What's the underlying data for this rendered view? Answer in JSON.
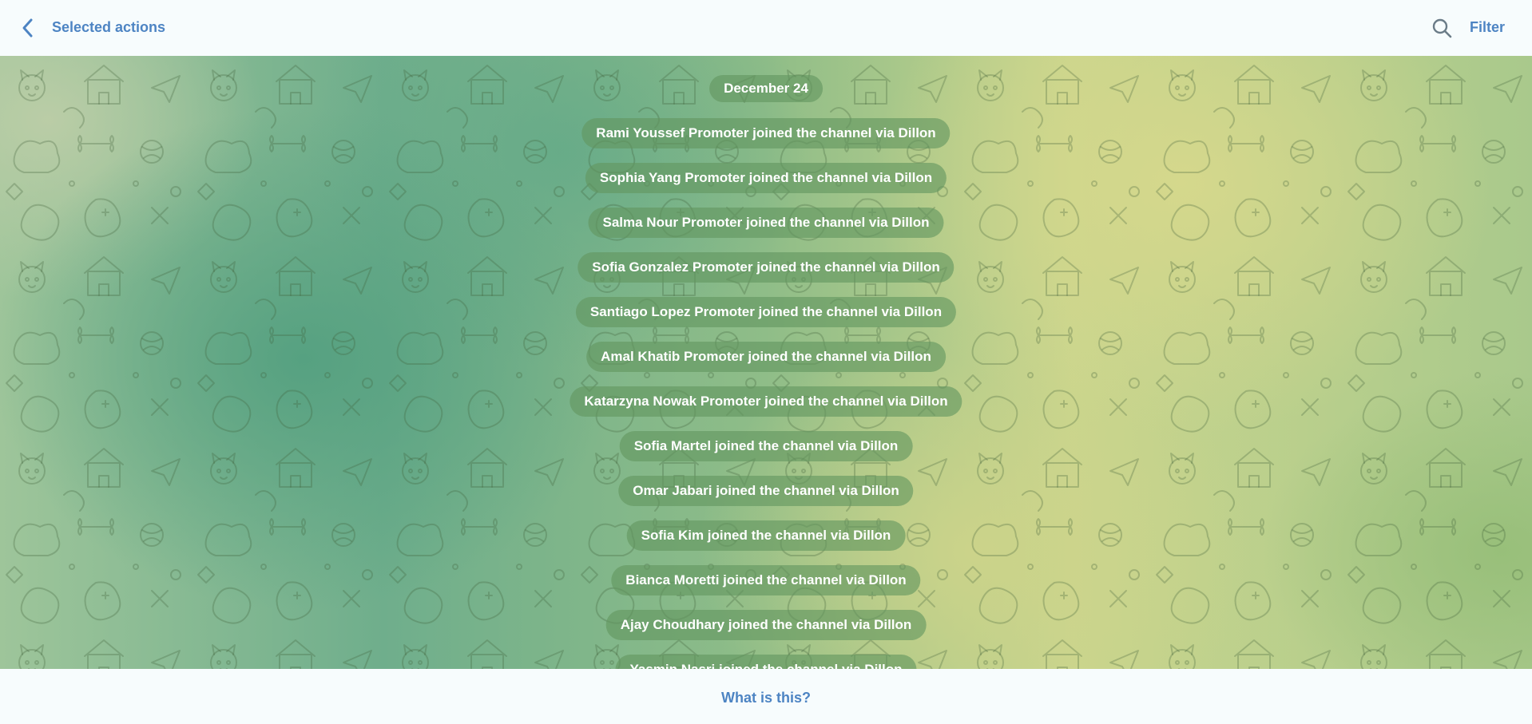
{
  "header": {
    "title": "Selected actions",
    "filter_label": "Filter"
  },
  "chat": {
    "date": "December 24",
    "messages": [
      "Rami Youssef Promoter joined the channel via Dillon",
      "Sophia Yang Promoter joined the channel via Dillon",
      "Salma Nour Promoter joined the channel via Dillon",
      "Sofia Gonzalez Promoter joined the channel via Dillon",
      "Santiago Lopez Promoter joined the channel via Dillon",
      "Amal Khatib Promoter joined the channel via Dillon",
      "Katarzyna Nowak Promoter joined the channel via Dillon",
      "Sofia Martel joined the channel via Dillon",
      "Omar Jabari joined the channel via Dillon",
      "Sofia Kim joined the channel via Dillon",
      "Bianca Moretti joined the channel via Dillon",
      "Ajay Choudhary joined the channel via Dillon",
      "Yasmin Nasri joined the channel via Dillon"
    ]
  },
  "footer": {
    "link_label": "What is this?"
  },
  "colors": {
    "accent": "#4d84c3",
    "header_bg": "#f7fcfd",
    "pill_bg": "rgba(98,150,96,0.62)"
  },
  "icons": {
    "back": "chevron-left-icon",
    "search": "search-icon"
  }
}
